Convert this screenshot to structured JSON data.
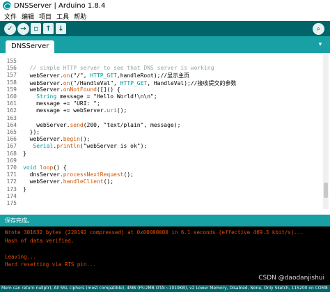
{
  "window": {
    "title": "DNSServer | Arduino 1.8.4"
  },
  "menu": [
    "文件",
    "编辑",
    "项目",
    "工具",
    "帮助"
  ],
  "toolbar": {
    "verify": "✓",
    "upload": "→",
    "new": "▫",
    "open": "↑",
    "save": "↓",
    "serial_monitor": "⌕"
  },
  "tabs": {
    "active": "DNSServer",
    "menu_glyph": "▾"
  },
  "editor": {
    "line_numbers": [
      "155",
      "156",
      "157",
      "158",
      "159",
      "160",
      "161",
      "162",
      "163",
      "164",
      "165",
      "166",
      "167",
      "168",
      "169",
      "170",
      "171",
      "172",
      "173",
      "174",
      "175"
    ],
    "lines": [
      [],
      [
        {
          "t": "  // simple HTTP server to see that DNS server is working",
          "c": "cm"
        }
      ],
      [
        {
          "t": "  webServer.",
          "c": ""
        },
        {
          "t": "on",
          "c": "fn"
        },
        {
          "t": "(\"/\", ",
          "c": ""
        },
        {
          "t": "HTTP_GET",
          "c": "kw"
        },
        {
          "t": ",handleRoot);//显示主页",
          "c": ""
        }
      ],
      [
        {
          "t": "  webServer.",
          "c": ""
        },
        {
          "t": "on",
          "c": "fn"
        },
        {
          "t": "(\"/HandleVal\", ",
          "c": ""
        },
        {
          "t": "HTTP_GET",
          "c": "kw"
        },
        {
          "t": ", HandleVal);//接收提交的参数",
          "c": ""
        }
      ],
      [
        {
          "t": "  webServer.",
          "c": ""
        },
        {
          "t": "onNotFound",
          "c": "fn"
        },
        {
          "t": "([]() {",
          "c": ""
        }
      ],
      [
        {
          "t": "    ",
          "c": ""
        },
        {
          "t": "String",
          "c": "kw"
        },
        {
          "t": " message = \"Hello World!\\n\\n\";",
          "c": ""
        }
      ],
      [
        {
          "t": "    message += \"URI: \";",
          "c": ""
        }
      ],
      [
        {
          "t": "    message += webServer.",
          "c": ""
        },
        {
          "t": "uri",
          "c": "fn"
        },
        {
          "t": "();",
          "c": ""
        }
      ],
      [],
      [
        {
          "t": "    webServer.",
          "c": ""
        },
        {
          "t": "send",
          "c": "fn"
        },
        {
          "t": "(200, \"text/plain\", message);",
          "c": ""
        }
      ],
      [
        {
          "t": "  });",
          "c": ""
        }
      ],
      [
        {
          "t": "  webServer.",
          "c": ""
        },
        {
          "t": "begin",
          "c": "fn"
        },
        {
          "t": "();",
          "c": ""
        }
      ],
      [
        {
          "t": "   ",
          "c": ""
        },
        {
          "t": "Serial",
          "c": "kw"
        },
        {
          "t": ".",
          "c": ""
        },
        {
          "t": "println",
          "c": "fn"
        },
        {
          "t": "(\"webServer is ok\");",
          "c": ""
        }
      ],
      [
        {
          "t": "}",
          "c": ""
        }
      ],
      [],
      [
        {
          "t": "void",
          "c": "kw"
        },
        {
          "t": " ",
          "c": ""
        },
        {
          "t": "loop",
          "c": "fn"
        },
        {
          "t": "() {",
          "c": ""
        }
      ],
      [
        {
          "t": "  dnsServer.",
          "c": ""
        },
        {
          "t": "processNextRequest",
          "c": "fn"
        },
        {
          "t": "();",
          "c": ""
        }
      ],
      [
        {
          "t": "  webServer.",
          "c": ""
        },
        {
          "t": "handleClient",
          "c": "fn"
        },
        {
          "t": "();",
          "c": ""
        }
      ],
      [
        {
          "t": "}",
          "c": ""
        }
      ],
      [],
      []
    ]
  },
  "status": {
    "message": "保存完成。"
  },
  "console": {
    "lines": [
      "Wrote 301632 bytes (220192 compressed) at 0x00000000 in 6.1 seconds (effective 469.3 kbit/s)...",
      "Hash of data verified.",
      "",
      "Leaving...",
      "Hard resetting via RTS pin..."
    ]
  },
  "bottombar": {
    "text": "Mem can return nullptr), All SSL ciphers (most compatible), 4MB (FS:2MB OTA:~1019KB), v2 Lower Memory, Disabled, None, Only Sketch, 115200 on COM8"
  },
  "watermark": "CSDN @daodanjishui",
  "colors": {
    "toolbar_bg": "#006468",
    "tab_bg": "#17a1a5",
    "console_bg": "#000000",
    "console_text": "#e34c00",
    "keyword": "#00979c",
    "function": "#d35400"
  }
}
